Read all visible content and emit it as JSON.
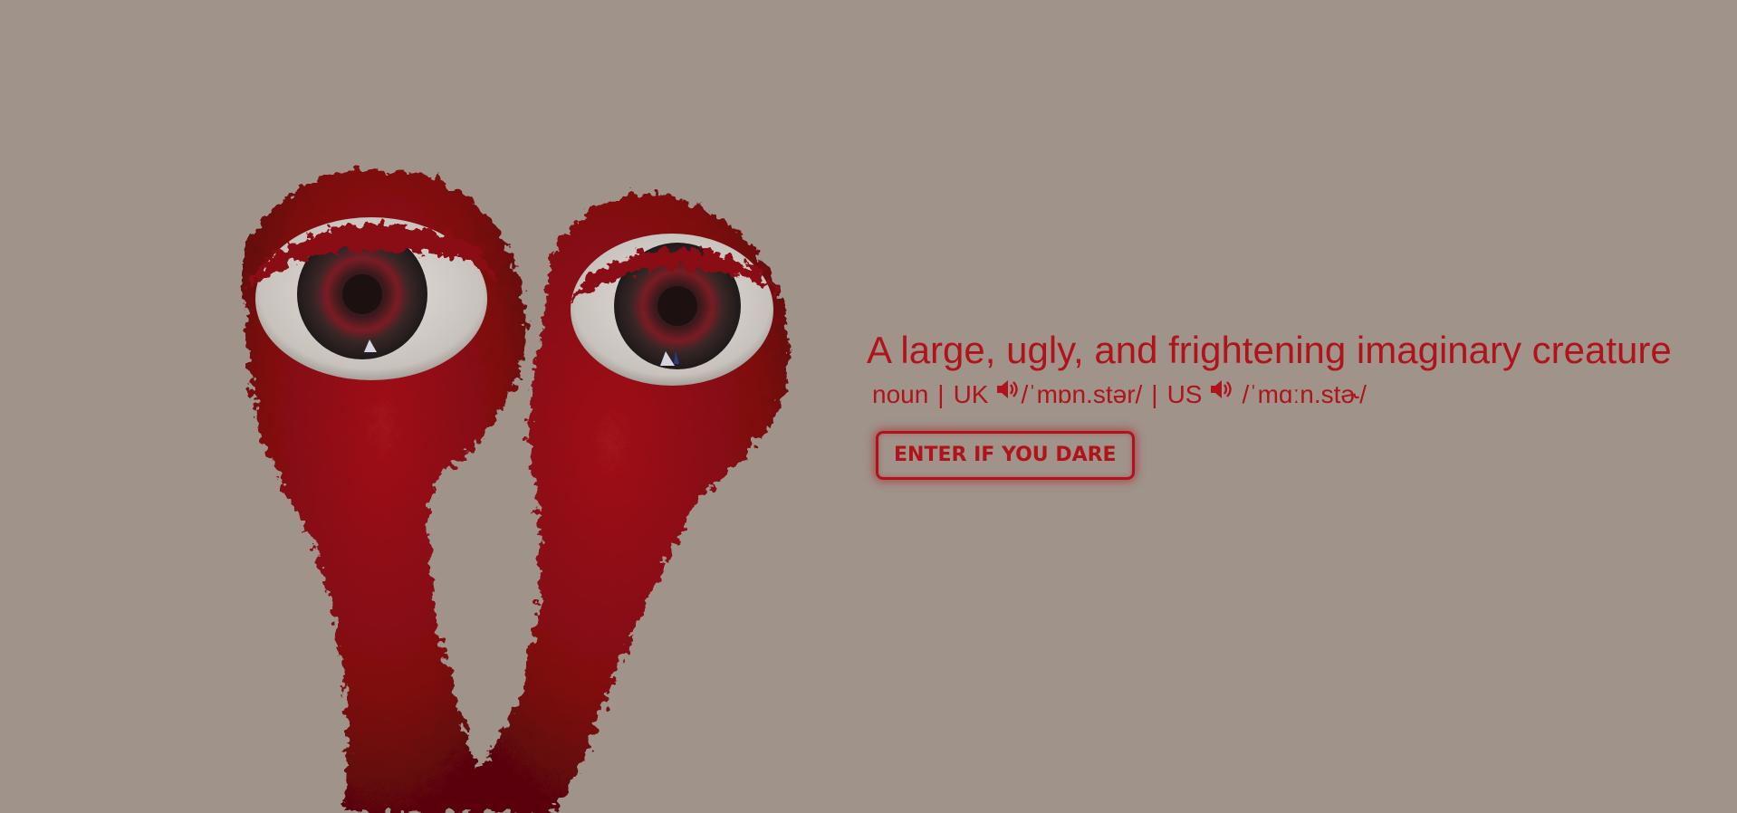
{
  "colors": {
    "background": "#9f938a",
    "accent": "#b0141a",
    "fur": "#8c0a10",
    "eye_white": "#cfcac5"
  },
  "hero": {
    "definition": "A large, ugly, and frightening imaginary creature",
    "part_of_speech": "noun",
    "separator": "|",
    "uk_label": "UK",
    "uk_pronunciation": "/ˈmɒn.stər/",
    "us_label": "US",
    "us_pronunciation": "/ˈmɑːn.stɚ/",
    "enter_button": "ENTER IF YOU DARE"
  },
  "icons": {
    "uk_audio": "speaker-icon",
    "us_audio": "speaker-icon"
  }
}
